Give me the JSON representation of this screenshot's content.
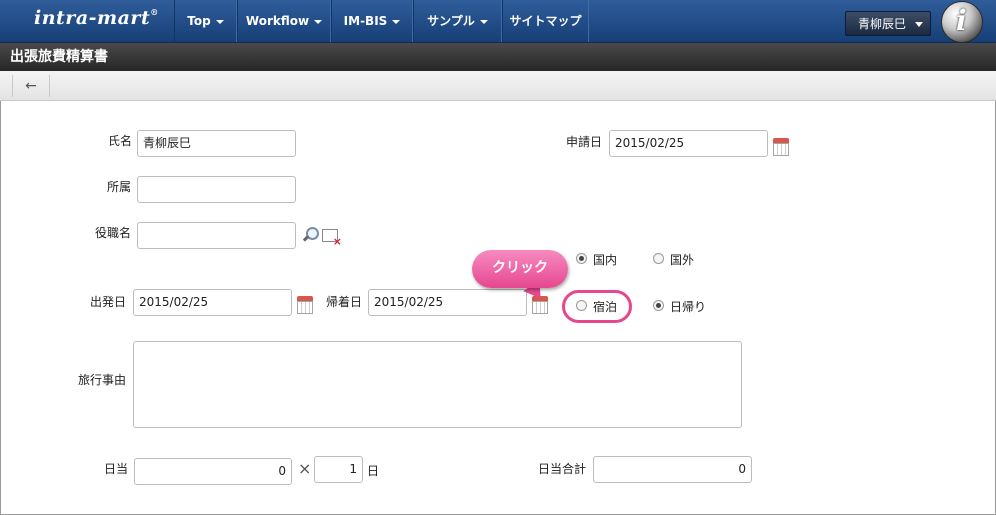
{
  "header": {
    "logo": "intra-mart",
    "logo_mark": "®",
    "nav": [
      "Top",
      "Workflow",
      "IM-BIS",
      "サンプル",
      "サイトマップ"
    ],
    "user": "青柳辰巳"
  },
  "page": {
    "title": "出張旅費精算書"
  },
  "form": {
    "name_label": "氏名",
    "name_value": "青柳辰巳",
    "dept_label": "所属",
    "dept_value": "",
    "post_label": "役職名",
    "post_value": "",
    "apply_label": "申請日",
    "apply_value": "2015/02/25",
    "domestic": "国内",
    "overseas": "国外",
    "overnight": "宿泊",
    "daytrip": "日帰り",
    "depart_label": "出発日",
    "depart_value": "2015/02/25",
    "return_label": "帰着日",
    "return_value": "2015/02/25",
    "reason_label": "旅行事由",
    "allow_label": "日当",
    "allow_value": "0",
    "times": "×",
    "days_value": "1",
    "days_unit": "日",
    "total_label": "日当合計",
    "total_value": "0"
  },
  "callout": {
    "text": "クリック",
    "color": "#e6478f"
  }
}
